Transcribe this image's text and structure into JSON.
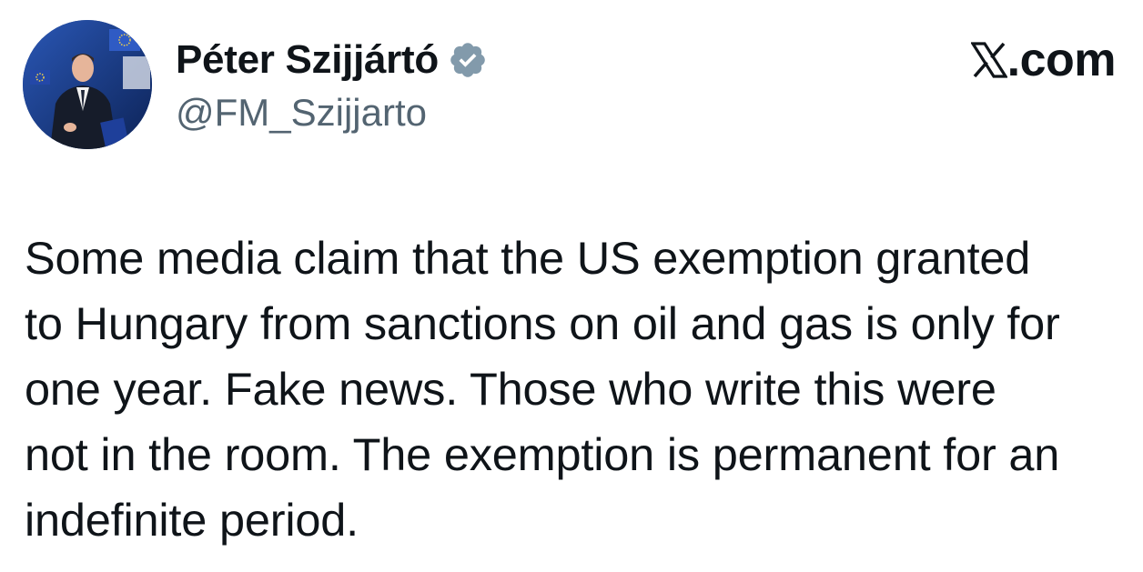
{
  "author": {
    "display_name": "Péter Szijjártó",
    "handle": "@FM_Szijjarto",
    "verified": true,
    "verified_badge_color": "#829aab",
    "avatar_icon": "profile-photo"
  },
  "brand": {
    "logo_icon": "x-logo-icon",
    "domain": ".com"
  },
  "tweet": {
    "text": "Some media claim that the US exemption granted\nto Hungary from sanctions on oil and gas is only for\none year. Fake news. Those who write this were\nnot in the room. The exemption is permanent for an\nindefinite period."
  },
  "colors": {
    "text_primary": "#0f1419",
    "text_secondary": "#536471",
    "background": "#ffffff"
  }
}
